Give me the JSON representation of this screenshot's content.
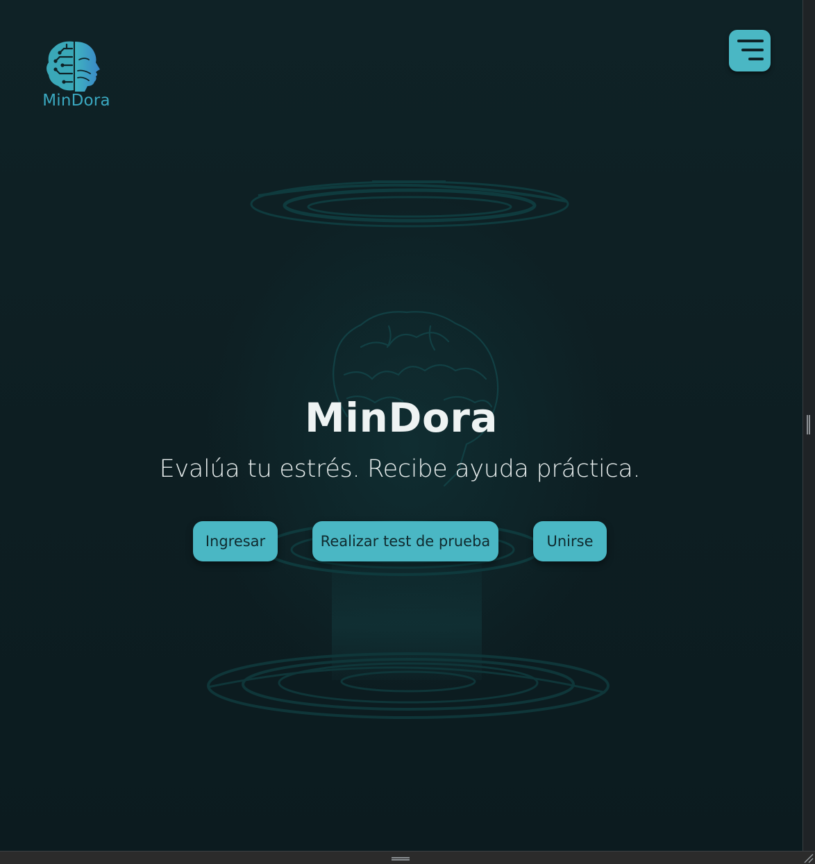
{
  "header": {
    "logo_text": "MinDora",
    "logo_icon": "brain-face-icon",
    "menu_icon": "menu-icon"
  },
  "hero": {
    "title": "MinDora",
    "subtitle": "Evalúa tu estrés. Recibe ayuda práctica.",
    "background_icon": "brain-outline-icon"
  },
  "actions": {
    "login_label": "Ingresar",
    "test_label": "Realizar test de prueba",
    "join_label": "Unirse"
  },
  "colors": {
    "accent": "#4ab7c4",
    "background": "#0e1f23",
    "logo": "#3aa8c0",
    "ring": "#0f3a3d",
    "text": "#eef3f3"
  }
}
